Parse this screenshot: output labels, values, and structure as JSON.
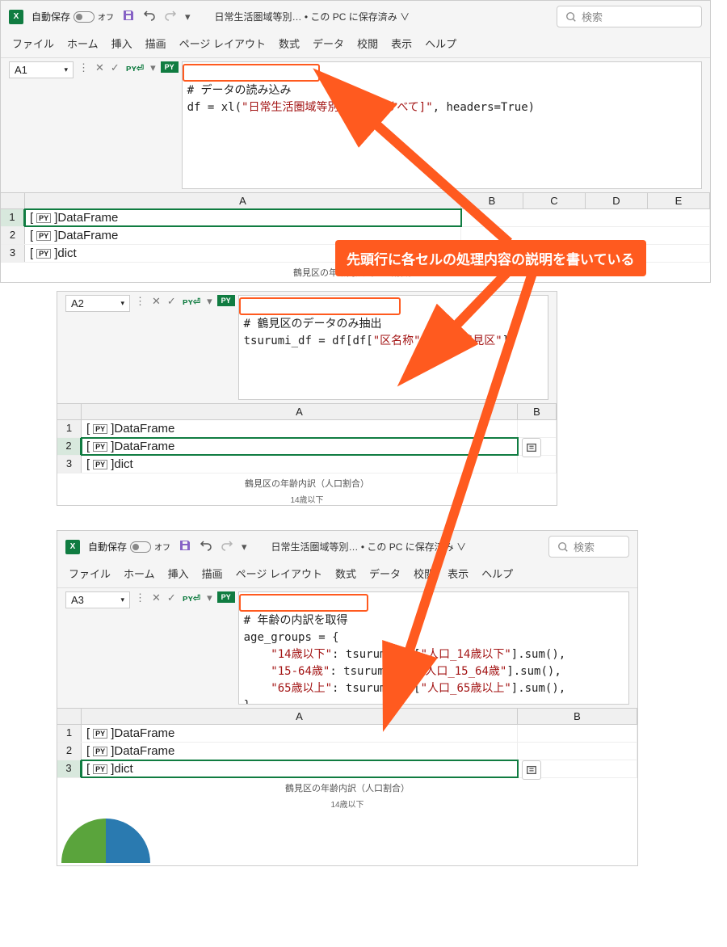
{
  "header": {
    "autosave_label": "自動保存",
    "autosave_state": "オフ",
    "doc_title": "日常生活圏域等別…  • この PC に保存済み ∨",
    "search_placeholder": "検索"
  },
  "ribbon": {
    "tabs": [
      "ファイル",
      "ホーム",
      "挿入",
      "描画",
      "ページ レイアウト",
      "数式",
      "データ",
      "校閲",
      "表示",
      "ヘルプ"
    ]
  },
  "annotation": {
    "text": "先頭行に各セルの処理内容の説明を書いている"
  },
  "pane1": {
    "namebox": "A1",
    "code_hl": "# データの読み込み",
    "code_line2a": "df = xl(",
    "code_line2b": "\"日常生活圏域等別データ[#すべて]\"",
    "code_line2c": ", headers=True)",
    "cols": [
      "A",
      "B",
      "C",
      "D",
      "E"
    ],
    "rows": [
      {
        "n": "1",
        "a": "DataFrame",
        "sel": true
      },
      {
        "n": "2",
        "a": "DataFrame"
      },
      {
        "n": "3",
        "a": "dict"
      }
    ],
    "chart_title": "鶴見区の年齢内訳（人口割合）"
  },
  "pane2": {
    "namebox": "A2",
    "code_hl": "# 鶴見区のデータのみ抽出",
    "code_line2a": "tsurumi_df = df[df[",
    "code_line2b": "\"区名称\"",
    "code_line2c": "] == ",
    "code_line2d": "\"鶴見区\"",
    "code_line2e": "]",
    "cols": [
      "A",
      "B"
    ],
    "rows": [
      {
        "n": "1",
        "a": "DataFrame"
      },
      {
        "n": "2",
        "a": "DataFrame",
        "sel": true
      },
      {
        "n": "3",
        "a": "dict"
      }
    ],
    "chart_title": "鶴見区の年齢内訳（人口割合）",
    "chart_sub": "14歳以下"
  },
  "pane3": {
    "namebox": "A3",
    "code_hl": "# 年齢の内訳を取得",
    "code_l2": "age_groups = {",
    "code_l3a": "    \"14歳以下\"",
    "code_l3b": ": tsurumi_df[",
    "code_l3c": "\"人口_14歳以下\"",
    "code_l3d": "].sum(),",
    "code_l4a": "    \"15-64歳\"",
    "code_l4b": ": tsurumi_df[",
    "code_l4c": "\"人口_15_64歳\"",
    "code_l4d": "].sum(),",
    "code_l5a": "    \"65歳以上\"",
    "code_l5b": ": tsurumi_df[",
    "code_l5c": "\"人口_65歳以上\"",
    "code_l5d": "].sum(),",
    "code_l6": "}",
    "cols": [
      "A",
      "B"
    ],
    "rows": [
      {
        "n": "1",
        "a": "DataFrame"
      },
      {
        "n": "2",
        "a": "DataFrame"
      },
      {
        "n": "3",
        "a": "dict",
        "sel": true
      }
    ],
    "chart_title": "鶴見区の年齢内訳（人口割合）",
    "chart_sub": "14歳以下"
  }
}
